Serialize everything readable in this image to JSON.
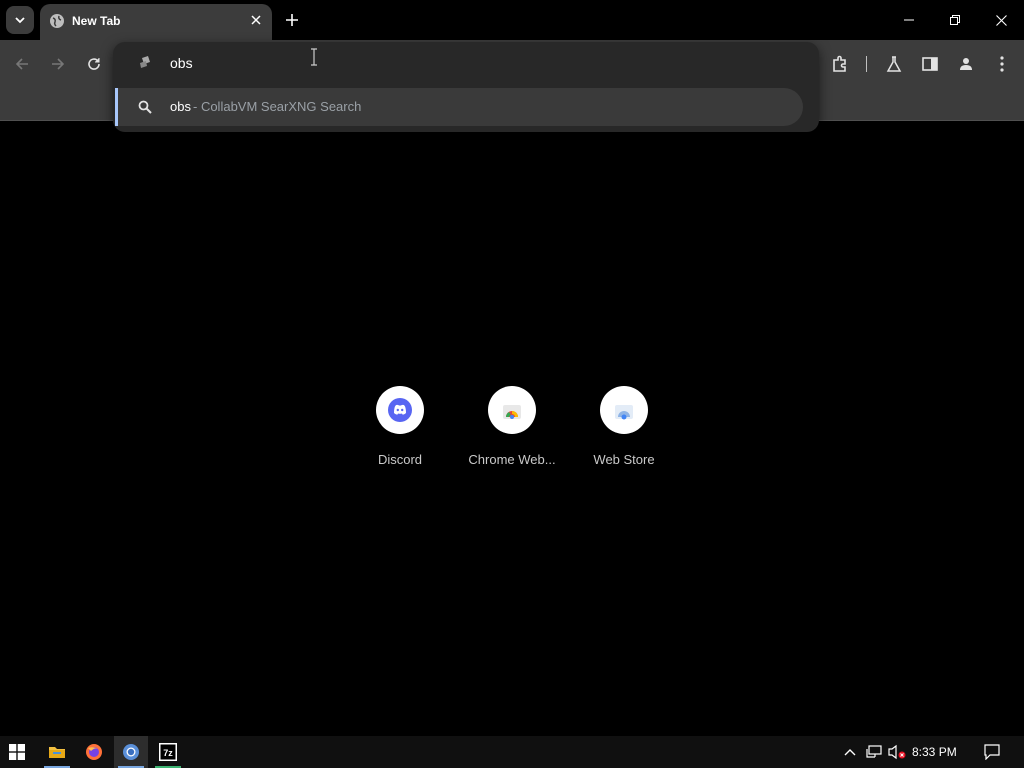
{
  "tab": {
    "title": "New Tab"
  },
  "omnibox": {
    "text": "obs"
  },
  "suggestion": {
    "query": "obs",
    "description": "- CollabVM SearXNG Search"
  },
  "shortcuts": [
    {
      "label": "Discord"
    },
    {
      "label": "Chrome Web..."
    },
    {
      "label": "Web Store"
    }
  ],
  "taskbar": {
    "clock": "8:33 PM"
  },
  "colors": {
    "toolbar": "#3c3c3c",
    "popup": "#282828",
    "accent": "#a8c7fa",
    "discord": "#5865f2"
  }
}
